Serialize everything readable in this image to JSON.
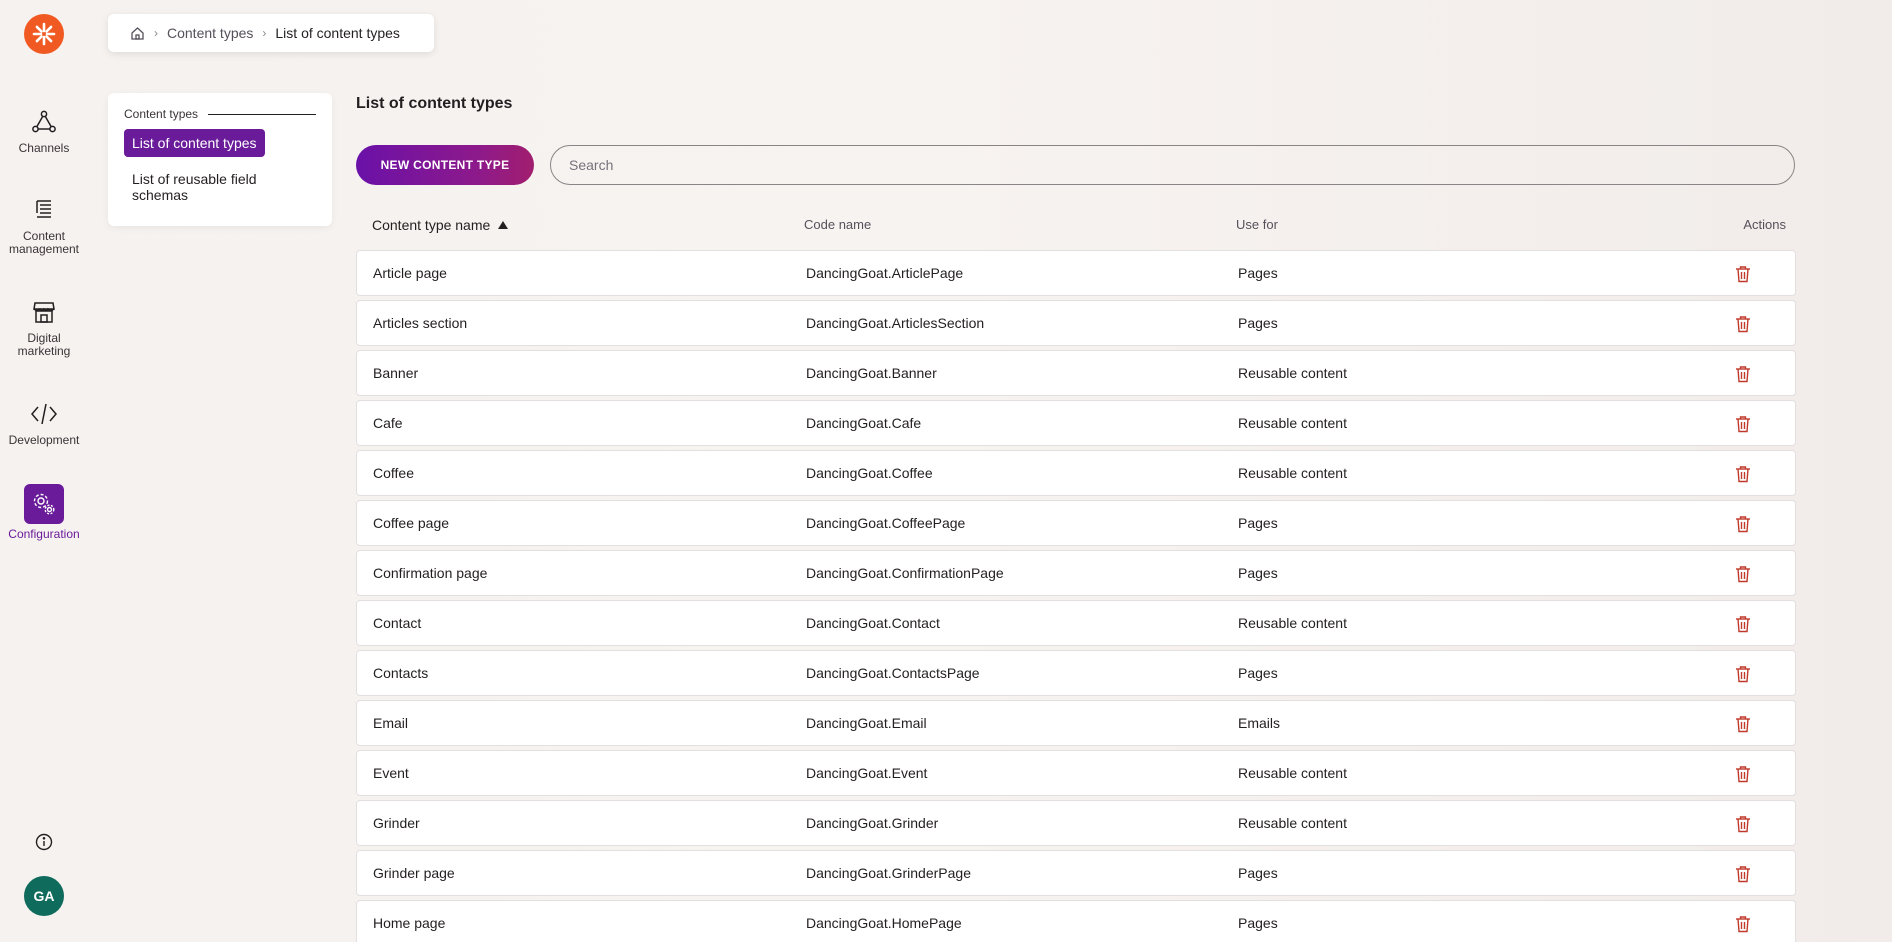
{
  "colors": {
    "accent": "#6a1b9a",
    "logo": "#f05a22",
    "avatar": "#0f6b5c",
    "delete": "#c0392b"
  },
  "rail": {
    "items": [
      {
        "label": "Channels",
        "icon": "channels-icon"
      },
      {
        "label": "Content management",
        "icon": "content-management-icon"
      },
      {
        "label": "Digital marketing",
        "icon": "digital-marketing-icon"
      },
      {
        "label": "Development",
        "icon": "code-icon"
      },
      {
        "label": "Configuration",
        "icon": "configuration-gear-icon",
        "active": true
      }
    ],
    "avatar_initials": "GA"
  },
  "breadcrumb": {
    "items": [
      "Content types",
      "List of content types"
    ]
  },
  "subnav": {
    "heading": "Content types",
    "items": [
      "List of content types",
      "List of reusable field schemas"
    ]
  },
  "page": {
    "title": "List of content types"
  },
  "toolbar": {
    "new_button": "NEW CONTENT TYPE",
    "search_placeholder": "Search"
  },
  "table": {
    "columns": [
      "Content type name",
      "Code name",
      "Use for",
      "Actions"
    ],
    "rows": [
      {
        "name": "Article page",
        "code": "DancingGoat.ArticlePage",
        "use": "Pages"
      },
      {
        "name": "Articles section",
        "code": "DancingGoat.ArticlesSection",
        "use": "Pages"
      },
      {
        "name": "Banner",
        "code": "DancingGoat.Banner",
        "use": "Reusable content"
      },
      {
        "name": "Cafe",
        "code": "DancingGoat.Cafe",
        "use": "Reusable content"
      },
      {
        "name": "Coffee",
        "code": "DancingGoat.Coffee",
        "use": "Reusable content"
      },
      {
        "name": "Coffee page",
        "code": "DancingGoat.CoffeePage",
        "use": "Pages"
      },
      {
        "name": "Confirmation page",
        "code": "DancingGoat.ConfirmationPage",
        "use": "Pages"
      },
      {
        "name": "Contact",
        "code": "DancingGoat.Contact",
        "use": "Reusable content"
      },
      {
        "name": "Contacts",
        "code": "DancingGoat.ContactsPage",
        "use": "Pages"
      },
      {
        "name": "Email",
        "code": "DancingGoat.Email",
        "use": "Emails"
      },
      {
        "name": "Event",
        "code": "DancingGoat.Event",
        "use": "Reusable content"
      },
      {
        "name": "Grinder",
        "code": "DancingGoat.Grinder",
        "use": "Reusable content"
      },
      {
        "name": "Grinder page",
        "code": "DancingGoat.GrinderPage",
        "use": "Pages"
      },
      {
        "name": "Home page",
        "code": "DancingGoat.HomePage",
        "use": "Pages"
      }
    ]
  }
}
